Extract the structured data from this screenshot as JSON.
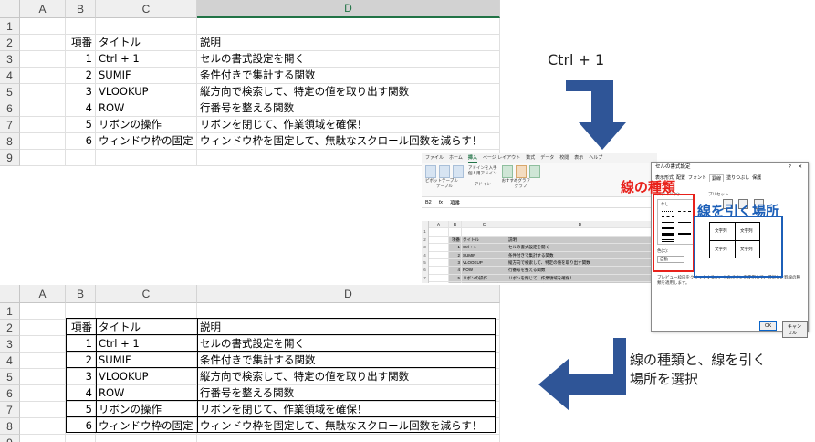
{
  "columns": [
    "A",
    "B",
    "C",
    "D"
  ],
  "rows": [
    {
      "num": "1",
      "b": "",
      "c": "",
      "d": ""
    },
    {
      "num": "2",
      "b": "項番",
      "c": "タイトル",
      "d": "説明"
    },
    {
      "num": "3",
      "b": "1",
      "c": "Ctrl + 1",
      "d": "セルの書式設定を開く"
    },
    {
      "num": "4",
      "b": "2",
      "c": "SUMIF",
      "d": "条件付きで集計する関数"
    },
    {
      "num": "5",
      "b": "3",
      "c": "VLOOKUP",
      "d": "縦方向で検索して、特定の値を取り出す関数"
    },
    {
      "num": "6",
      "b": "4",
      "c": "ROW",
      "d": "行番号を整える関数"
    },
    {
      "num": "7",
      "b": "5",
      "c": "リボンの操作",
      "d": "リボンを閉じて、作業領域を確保！"
    },
    {
      "num": "8",
      "b": "6",
      "c": "ウィンドウ枠の固定",
      "d": "ウィンドウ枠を固定して、無駄なスクロール回数を減らす！"
    },
    {
      "num": "9",
      "b": "",
      "c": "",
      "d": ""
    }
  ],
  "annotations": {
    "step1": "Ctrl + 1",
    "step2": "線の種類と、線を引く場所を選択",
    "line_type": "線の種類",
    "line_place": "線を引く場所"
  },
  "mini_excel": {
    "tabs": [
      "ファイル",
      "ホーム",
      "挿入",
      "ページ レイアウト",
      "数式",
      "データ",
      "校閲",
      "表示",
      "ヘルプ"
    ],
    "active_tab": "挿入",
    "name_box": "B2",
    "formula": "項番",
    "ribbon_groups": [
      "テーブル",
      "アドイン",
      "グラフ"
    ],
    "ribbon_items": [
      "ピボットテーブル",
      "おすすめピボットテーブル",
      "テーブル",
      "アドインを入手",
      "個人用アドイン",
      "おすすめグラフ",
      "マップ",
      "ピボットグラフ"
    ]
  },
  "dialog": {
    "title": "セルの書式設定",
    "title_controls": "? ✕",
    "tabs": [
      "表示形式",
      "配置",
      "フォント",
      "罫線",
      "塗りつぶし",
      "保護"
    ],
    "active_tab": "罫線",
    "style_label": "スタイル(S):",
    "none_label": "なし",
    "preset_label": "プリセット",
    "color_label": "色(C):",
    "color_value": "自動",
    "preview_text": "文字列",
    "caption": "プレビュー枠内をクリックするか、上のボタンを使用して、選択した罫線の種類を適用します。",
    "ok": "OK",
    "cancel": "キャンセル"
  },
  "colors": {
    "arrow": "#2f5597",
    "red": "#e8211b",
    "blue": "#1c5fb8"
  }
}
